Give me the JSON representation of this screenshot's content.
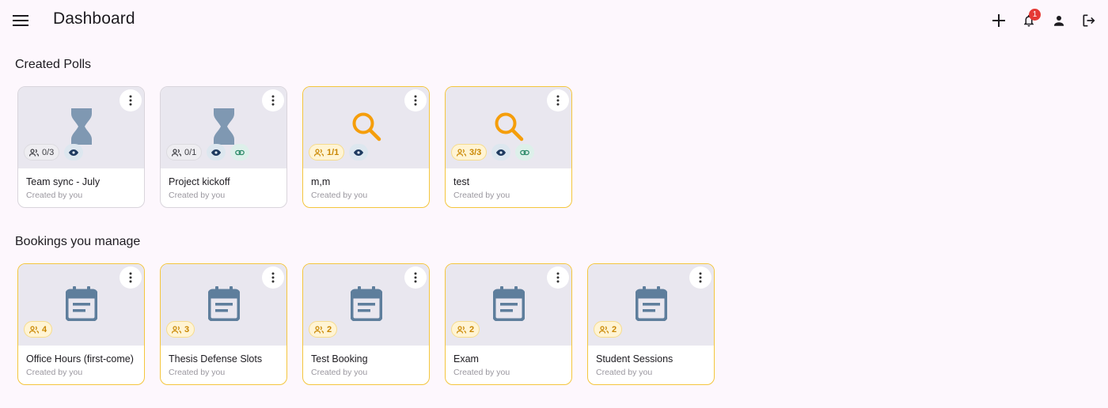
{
  "header": {
    "title": "Dashboard",
    "notification_count": "1"
  },
  "sections": {
    "polls_title": "Created Polls",
    "bookings_title": "Bookings you manage"
  },
  "polls": [
    {
      "name": "Team sync - July",
      "by": "Created by you",
      "count": "0/3"
    },
    {
      "name": "Project kickoff",
      "by": "Created by you",
      "count": "0/1"
    },
    {
      "name": "m,m",
      "by": "Created by you",
      "count": "1/1"
    },
    {
      "name": "test",
      "by": "Created by you",
      "count": "3/3"
    }
  ],
  "bookings": [
    {
      "name": "Office Hours (first-come)",
      "by": "Created by you",
      "count": "4"
    },
    {
      "name": "Thesis Defense Slots",
      "by": "Created by you",
      "count": "3"
    },
    {
      "name": "Test Booking",
      "by": "Created by you",
      "count": "2"
    },
    {
      "name": "Exam",
      "by": "Created by you",
      "count": "2"
    },
    {
      "name": "Student Sessions",
      "by": "Created by you",
      "count": "2"
    }
  ],
  "colors": {
    "background": "#fdf7fd",
    "highlight_border": "#f4c63d",
    "pending_icon": "#7f98b2",
    "search_icon": "#f59e0b",
    "calendar_icon": "#5e7e9c",
    "gold_text": "#c98600",
    "badge": "#e53935"
  }
}
